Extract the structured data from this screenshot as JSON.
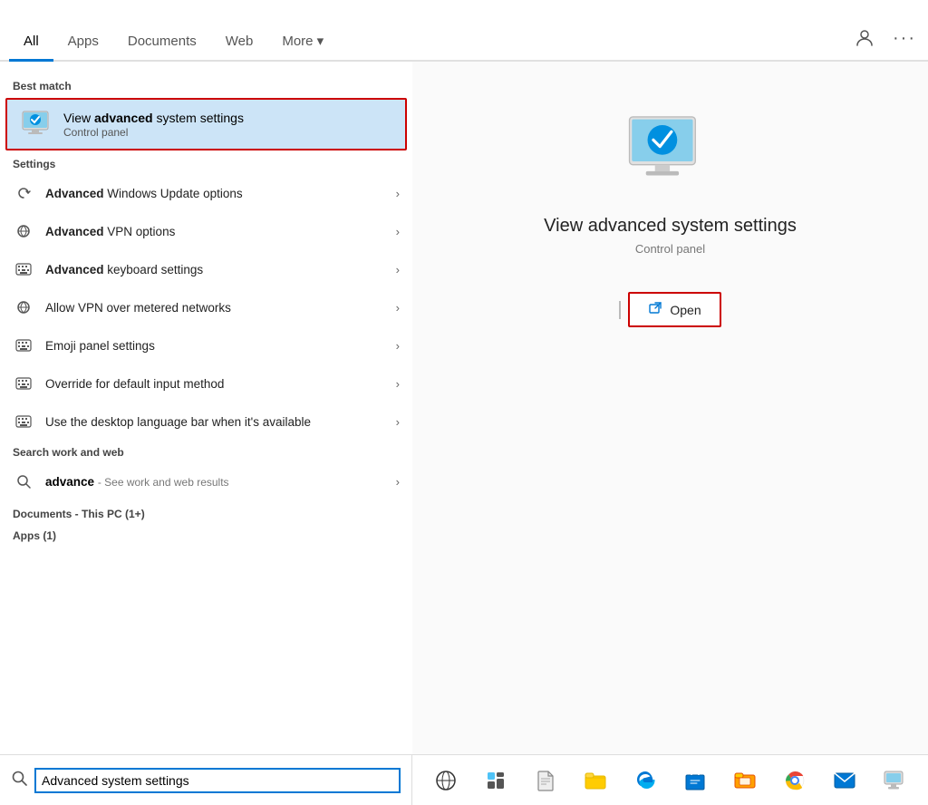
{
  "tabs": {
    "items": [
      {
        "label": "All",
        "active": true
      },
      {
        "label": "Apps",
        "active": false
      },
      {
        "label": "Documents",
        "active": false
      },
      {
        "label": "Web",
        "active": false
      },
      {
        "label": "More ▾",
        "active": false
      }
    ]
  },
  "header_icons": {
    "account": "👤",
    "more": "···"
  },
  "best_match": {
    "section_label": "Best match",
    "title_plain": "View ",
    "title_bold": "advanced",
    "title_rest": " system settings",
    "subtitle": "Control panel"
  },
  "settings": {
    "section_label": "Settings",
    "items": [
      {
        "icon": "↻",
        "text_plain": "",
        "text_bold": "Advanced",
        "text_rest": " Windows Update options",
        "chevron": "›"
      },
      {
        "icon": "⊙",
        "text_plain": "",
        "text_bold": "Advanced",
        "text_rest": " VPN options",
        "chevron": "›"
      },
      {
        "icon": "⌨",
        "text_plain": "",
        "text_bold": "Advanced",
        "text_rest": " keyboard settings",
        "chevron": "›"
      },
      {
        "icon": "⊙",
        "text_plain": "Allow VPN over metered networks",
        "text_bold": "",
        "text_rest": "",
        "chevron": "›"
      },
      {
        "icon": "⌨",
        "text_plain": "Emoji panel settings",
        "text_bold": "",
        "text_rest": "",
        "chevron": "›"
      },
      {
        "icon": "⌨",
        "text_plain": "Override for default input method",
        "text_bold": "",
        "text_rest": "",
        "chevron": "›"
      },
      {
        "icon": "⌨",
        "text_plain": "Use the desktop language bar when it's available",
        "text_bold": "",
        "text_rest": "",
        "chevron": "›"
      }
    ]
  },
  "search_web": {
    "section_label": "Search work and web",
    "query": "advance",
    "sub": "- See work and web results",
    "chevron": "›"
  },
  "documents": {
    "label": "Documents - This PC (1+)"
  },
  "apps": {
    "label": "Apps (1)"
  },
  "right_panel": {
    "title": "View advanced system settings",
    "subtitle": "Control panel",
    "open_label": "Open"
  },
  "taskbar": {
    "search_value": "Advanced system settings",
    "search_placeholder": "Advanced system settings",
    "icons": [
      {
        "name": "task-view",
        "symbol": "⊙"
      },
      {
        "name": "widgets",
        "symbol": "▦"
      },
      {
        "name": "file-explorer",
        "symbol": "📄"
      },
      {
        "name": "file-explorer2",
        "symbol": "📁"
      },
      {
        "name": "edge",
        "symbol": "🌐"
      },
      {
        "name": "store",
        "symbol": "🛍"
      },
      {
        "name": "file-manager",
        "symbol": "🗂"
      },
      {
        "name": "chrome",
        "symbol": "⬤"
      },
      {
        "name": "mail",
        "symbol": "✉"
      },
      {
        "name": "settings2",
        "symbol": "🖥"
      }
    ]
  }
}
